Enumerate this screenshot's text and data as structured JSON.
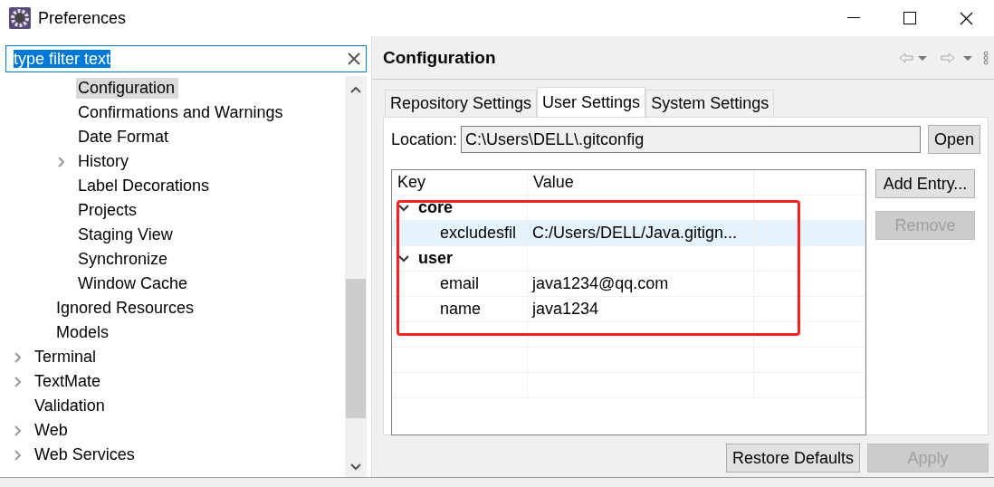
{
  "window": {
    "title": "Preferences"
  },
  "filter": {
    "value": "type filter text",
    "text_selected": true
  },
  "tree": {
    "items": [
      {
        "children": [
          {
            "children": [
              {
                "label": "Configuration",
                "selected": true,
                "expandable": false
              },
              {
                "label": "Confirmations and Warnings",
                "selected": false,
                "expandable": false
              },
              {
                "label": "Date Format",
                "selected": false,
                "expandable": false
              },
              {
                "label": "History",
                "selected": false,
                "expandable": true
              },
              {
                "label": "Label Decorations",
                "selected": false,
                "expandable": false
              },
              {
                "label": "Projects",
                "selected": false,
                "expandable": false
              },
              {
                "label": "Staging View",
                "selected": false,
                "expandable": false
              },
              {
                "label": "Synchronize",
                "selected": false,
                "expandable": false
              },
              {
                "label": "Window Cache",
                "selected": false,
                "expandable": false
              }
            ]
          },
          {
            "label": "Ignored Resources",
            "selected": false,
            "expandable": false
          },
          {
            "label": "Models",
            "selected": false,
            "expandable": false
          }
        ]
      },
      {
        "label": "Terminal",
        "selected": false,
        "expandable": true
      },
      {
        "label": "TextMate",
        "selected": false,
        "expandable": true
      },
      {
        "label": "Validation",
        "selected": false,
        "expandable": false
      },
      {
        "label": "Web",
        "selected": false,
        "expandable": true
      },
      {
        "label": "Web Services",
        "selected": false,
        "expandable": true
      }
    ]
  },
  "page": {
    "title": "Configuration",
    "tabs": [
      {
        "label": "Repository Settings",
        "selected": false
      },
      {
        "label": "User Settings",
        "selected": true
      },
      {
        "label": "System Settings",
        "selected": false
      }
    ],
    "location": {
      "label": "Location:",
      "value": "C:\\Users\\DELL\\.gitconfig",
      "button": "Open"
    },
    "table": {
      "columns": [
        "Key",
        "Value"
      ],
      "rows": [
        {
          "key": "core",
          "expanded": true,
          "selected": false,
          "children": [
            {
              "key": "excludesfil",
              "value": "C:/Users/DELL/Java.gitign...",
              "selected": true
            }
          ]
        },
        {
          "key": "user",
          "expanded": true,
          "selected": false,
          "children": [
            {
              "key": "email",
              "value": "java1234@qq.com",
              "selected": false
            },
            {
              "key": "name",
              "value": "java1234",
              "selected": false
            }
          ]
        }
      ]
    },
    "side_buttons": [
      {
        "label": "Add Entry...",
        "disabled": false
      },
      {
        "label": "Remove",
        "disabled": true
      }
    ],
    "bottom_buttons": [
      {
        "label": "Restore Defaults",
        "disabled": false
      },
      {
        "label": "Apply",
        "disabled": true
      }
    ]
  }
}
